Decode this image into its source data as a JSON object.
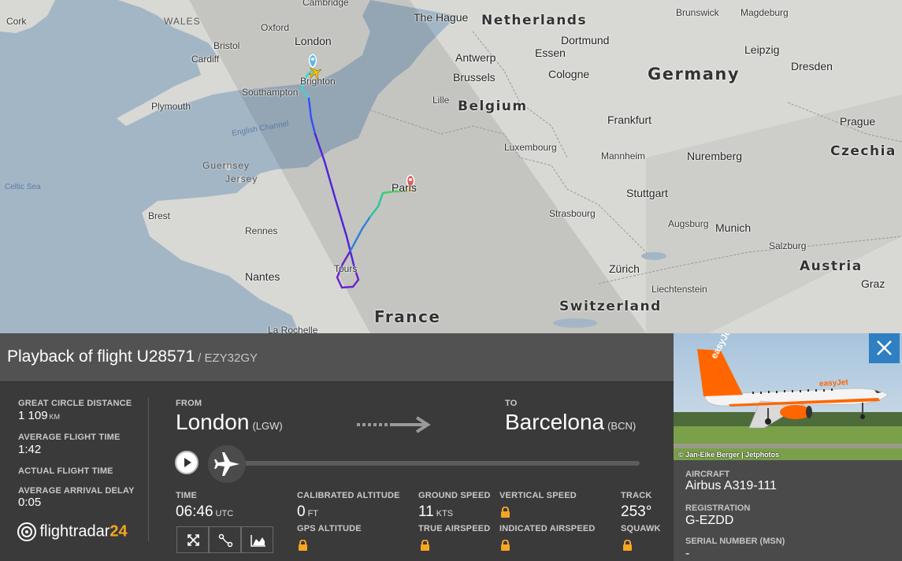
{
  "map": {
    "labels": {
      "cork": "Cork",
      "wales": "WALES",
      "bristol": "Bristol",
      "oxford": "Oxford",
      "cambridge": "Cambridge",
      "london": "London",
      "cardiff": "Cardiff",
      "brighton": "Brighton",
      "southampton": "Southampton",
      "plymouth": "Plymouth",
      "english_channel": "English Channel",
      "celtic_sea": "Celtic Sea",
      "guernsey": "Guernsey",
      "jersey": "Jersey",
      "brest": "Brest",
      "rennes": "Rennes",
      "nantes": "Nantes",
      "tours": "Tours",
      "la_rochelle": "La Rochelle",
      "paris": "Paris",
      "france": "France",
      "the_hague": "The Hague",
      "netherlands": "Netherlands",
      "antwerp": "Antwerp",
      "brussels": "Brussels",
      "lille": "Lille",
      "belgium": "Belgium",
      "luxembourg": "Luxembourg",
      "dortmund": "Dortmund",
      "essen": "Essen",
      "cologne": "Cologne",
      "germany": "Germany",
      "frankfurt": "Frankfurt",
      "mannheim": "Mannheim",
      "stuttgart": "Stuttgart",
      "strasbourg": "Strasbourg",
      "nuremberg": "Nuremberg",
      "augsburg": "Augsburg",
      "munich": "Munich",
      "zurich": "Zürich",
      "liechtenstein": "Liechtenstein",
      "switzerland": "Switzerland",
      "brunswick": "Brunswick",
      "magdeburg": "Magdeburg",
      "leipzig": "Leipzig",
      "dresden": "Dresden",
      "prague": "Prague",
      "czechia": "Czechia",
      "salzburg": "Salzburg",
      "austria": "Austria",
      "graz": "Graz"
    }
  },
  "panel": {
    "title": "Playback of flight U28571",
    "callsign": "/ EZY32GY",
    "stats": {
      "great_circle_label": "GREAT CIRCLE DISTANCE",
      "great_circle_value": "1 109",
      "great_circle_unit": "KM",
      "avg_flight_time_label": "AVERAGE FLIGHT TIME",
      "avg_flight_time_value": "1:42",
      "actual_flight_time_label": "ACTUAL FLIGHT TIME",
      "avg_arrival_delay_label": "AVERAGE ARRIVAL DELAY",
      "avg_arrival_delay_value": "0:05"
    },
    "logo_text": "flightradar",
    "logo_number": "24",
    "from_label": "FROM",
    "from_city": "London",
    "from_code": "(LGW)",
    "to_label": "TO",
    "to_city": "Barcelona",
    "to_code": "(BCN)",
    "time_label": "TIME",
    "time_value": "06:46",
    "time_unit": "UTC",
    "cal_alt_label": "CALIBRATED ALTITUDE",
    "cal_alt_value": "0",
    "cal_alt_unit": "FT",
    "gps_alt_label": "GPS ALTITUDE",
    "ground_speed_label": "GROUND SPEED",
    "ground_speed_value": "11",
    "ground_speed_unit": "KTS",
    "true_airspeed_label": "TRUE AIRSPEED",
    "vertical_speed_label": "VERTICAL SPEED",
    "indicated_airspeed_label": "INDICATED AIRSPEED",
    "track_label": "TRACK",
    "track_value": "253°",
    "squawk_label": "SQUAWK"
  },
  "aircraft": {
    "photo_credit": "© Jan-Eike Berger | Jetphotos",
    "livery_text": "easyJet",
    "aircraft_label": "AIRCRAFT",
    "aircraft_value": "Airbus A319-111",
    "registration_label": "REGISTRATION",
    "registration_value": "G-EZDD",
    "serial_label": "SERIAL NUMBER (MSN)",
    "serial_value": "-"
  },
  "colors": {
    "accent_blue": "#2f7fc2",
    "panel_dark": "#3a3a3a",
    "header_gray": "#525252",
    "logo_orange": "#f5a623"
  },
  "icons": [
    "play-icon",
    "plane-icon",
    "arrow-right-icon",
    "lock-icon",
    "close-icon",
    "expand-icon",
    "route-icon",
    "chart-icon",
    "origin-pin-icon",
    "destination-pin-icon"
  ]
}
